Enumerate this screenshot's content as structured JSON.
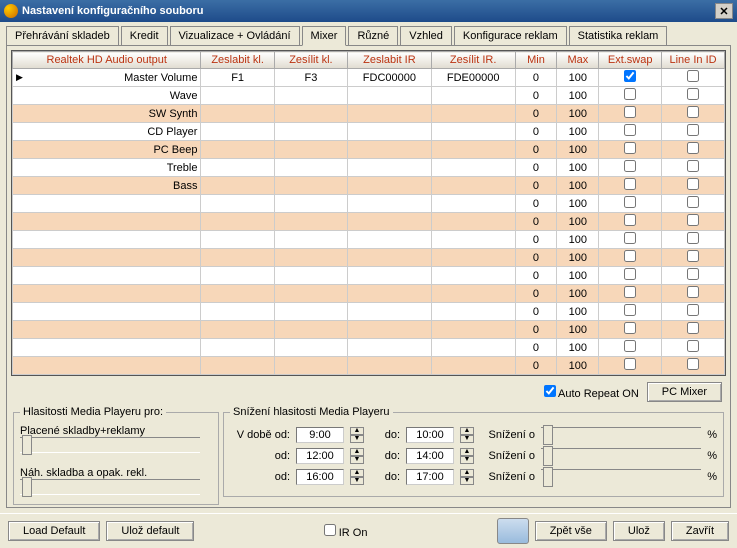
{
  "window": {
    "title": "Nastavení konfiguračního souboru",
    "close": "✕"
  },
  "tabs": [
    "Přehrávání skladeb",
    "Kredit",
    "Vizualizace + Ovládání",
    "Mixer",
    "Různé",
    "Vzhled",
    "Konfigurace reklam",
    "Statistika reklam"
  ],
  "activeTab": 3,
  "columns": [
    "Realtek HD Audio output",
    "Zeslabit kl.",
    "Zesílit kl.",
    "Zeslabit IR",
    "Zesílit IR.",
    "Min",
    "Max",
    "Ext.swap",
    "Line In ID"
  ],
  "rows": [
    {
      "n": "Master Volume",
      "a": "F1",
      "b": "F3",
      "c": "FDC00000",
      "d": "FDE00000",
      "min": 0,
      "max": 100,
      "ext": true,
      "lin": false,
      "sel": true
    },
    {
      "n": "Wave",
      "a": "",
      "b": "",
      "c": "",
      "d": "",
      "min": 0,
      "max": 100,
      "ext": false,
      "lin": false
    },
    {
      "n": "SW Synth",
      "a": "",
      "b": "",
      "c": "",
      "d": "",
      "min": 0,
      "max": 100,
      "ext": false,
      "lin": false
    },
    {
      "n": "CD Player",
      "a": "",
      "b": "",
      "c": "",
      "d": "",
      "min": 0,
      "max": 100,
      "ext": false,
      "lin": false
    },
    {
      "n": "PC Beep",
      "a": "",
      "b": "",
      "c": "",
      "d": "",
      "min": 0,
      "max": 100,
      "ext": false,
      "lin": false
    },
    {
      "n": "Treble",
      "a": "",
      "b": "",
      "c": "",
      "d": "",
      "min": 0,
      "max": 100,
      "ext": false,
      "lin": false
    },
    {
      "n": "Bass",
      "a": "",
      "b": "",
      "c": "",
      "d": "",
      "min": 0,
      "max": 100,
      "ext": false,
      "lin": false
    },
    {
      "n": "",
      "a": "",
      "b": "",
      "c": "",
      "d": "",
      "min": 0,
      "max": 100,
      "ext": false,
      "lin": false
    },
    {
      "n": "",
      "a": "",
      "b": "",
      "c": "",
      "d": "",
      "min": 0,
      "max": 100,
      "ext": false,
      "lin": false
    },
    {
      "n": "",
      "a": "",
      "b": "",
      "c": "",
      "d": "",
      "min": 0,
      "max": 100,
      "ext": false,
      "lin": false
    },
    {
      "n": "",
      "a": "",
      "b": "",
      "c": "",
      "d": "",
      "min": 0,
      "max": 100,
      "ext": false,
      "lin": false
    },
    {
      "n": "",
      "a": "",
      "b": "",
      "c": "",
      "d": "",
      "min": 0,
      "max": 100,
      "ext": false,
      "lin": false
    },
    {
      "n": "",
      "a": "",
      "b": "",
      "c": "",
      "d": "",
      "min": 0,
      "max": 100,
      "ext": false,
      "lin": false
    },
    {
      "n": "",
      "a": "",
      "b": "",
      "c": "",
      "d": "",
      "min": 0,
      "max": 100,
      "ext": false,
      "lin": false
    },
    {
      "n": "",
      "a": "",
      "b": "",
      "c": "",
      "d": "",
      "min": 0,
      "max": 100,
      "ext": false,
      "lin": false
    },
    {
      "n": "",
      "a": "",
      "b": "",
      "c": "",
      "d": "",
      "min": 0,
      "max": 100,
      "ext": false,
      "lin": false
    },
    {
      "n": "",
      "a": "",
      "b": "",
      "c": "",
      "d": "",
      "min": 0,
      "max": 100,
      "ext": false,
      "lin": false
    }
  ],
  "autoRepeat": {
    "label": "Auto Repeat ON",
    "checked": true
  },
  "pcMixer": "PC Mixer",
  "volGroup": {
    "title": "Hlasitosti Media Playeru pro:",
    "paid": "Placené skladby+reklamy",
    "preview": "Náh. skladba a opak. rekl."
  },
  "reduceGroup": {
    "title": "Snížení hlasitosti Media Playeru",
    "fromLabel": "V době od:",
    "odLabel": "od:",
    "doLabel": "do:",
    "reduceLabel": "Snížení o",
    "pct": "%",
    "rows": [
      {
        "from": "9:00",
        "to": "10:00"
      },
      {
        "from": "12:00",
        "to": "14:00"
      },
      {
        "from": "16:00",
        "to": "17:00"
      }
    ]
  },
  "footer": {
    "loadDefault": "Load Default",
    "ulozDefault": "Ulož default",
    "irOn": "IR On",
    "irChecked": false,
    "zpet": "Zpět vše",
    "uloz": "Ulož",
    "zavrit": "Zavřít"
  }
}
